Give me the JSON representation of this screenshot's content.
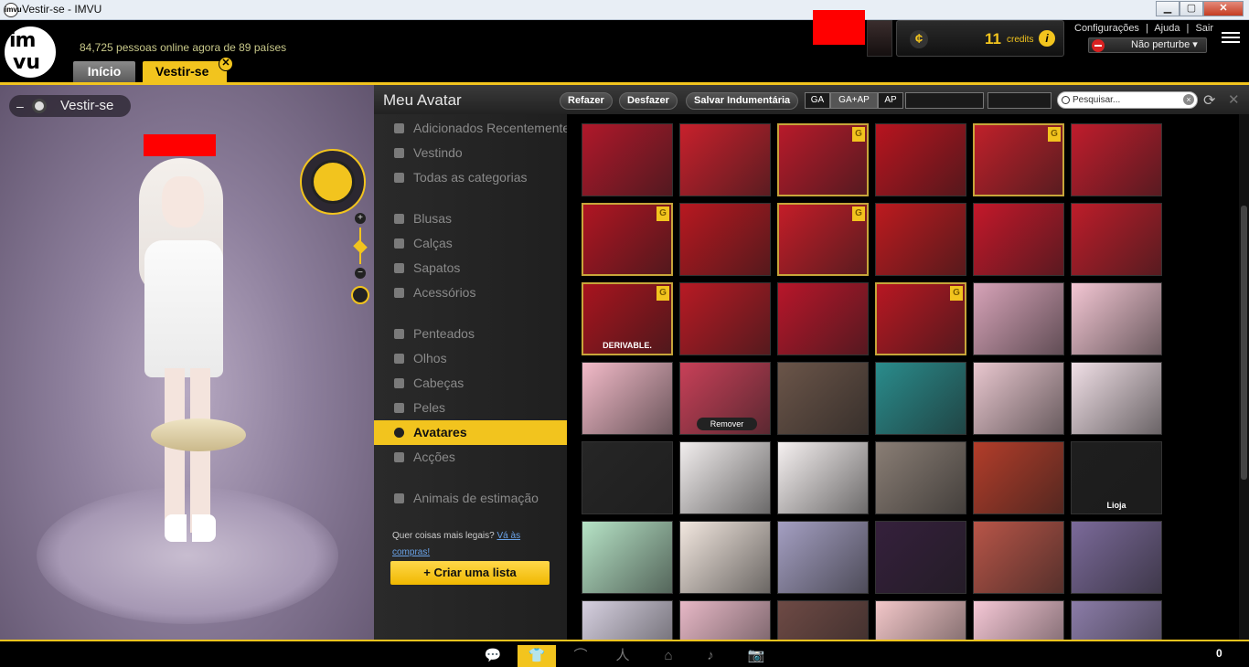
{
  "window": {
    "title": "Vestir-se - IMVU",
    "minimize": "▁",
    "maximize": "▢",
    "close": "✕"
  },
  "header": {
    "logo_top": "im",
    "logo_bottom": "vu",
    "online_text": "84,725 pessoas online agora de 89 países",
    "tabs": [
      {
        "label": "Início"
      },
      {
        "label": "Vestir-se"
      }
    ],
    "credits_value": "11",
    "credits_label": "credits",
    "menu": [
      "Configurações",
      "|",
      "Ajuda",
      "|",
      "Sair"
    ],
    "status": "Não perturbe"
  },
  "avatar_view": {
    "label": "Vestir-se",
    "minimize": "–"
  },
  "panel": {
    "title": "Meu Avatar",
    "buttons": {
      "redo": "Refazer",
      "undo": "Desfazer",
      "save": "Salvar Indumentária"
    },
    "ratings": [
      "GA",
      "GA+AP",
      "AP"
    ],
    "search_placeholder": "Pesquisar...",
    "search_clear": "×"
  },
  "categories": [
    {
      "label": "Adicionados Recentemente",
      "icon": "tag-icon",
      "active": false
    },
    {
      "label": "Vestindo",
      "icon": "person-icon",
      "active": false
    },
    {
      "label": "Todas as categorias",
      "icon": "star-icon",
      "active": false
    },
    {
      "label": "Blusas",
      "icon": "shirt-icon",
      "active": false
    },
    {
      "label": "Calças",
      "icon": "pants-icon",
      "active": false
    },
    {
      "label": "Sapatos",
      "icon": "shoe-icon",
      "active": false
    },
    {
      "label": "Acessórios",
      "icon": "gem-icon",
      "active": false
    },
    {
      "label": "Penteados",
      "icon": "hair-icon",
      "active": false
    },
    {
      "label": "Olhos",
      "icon": "eye-icon",
      "active": false
    },
    {
      "label": "Cabeças",
      "icon": "head-icon",
      "active": false
    },
    {
      "label": "Peles",
      "icon": "lips-icon",
      "active": false
    },
    {
      "label": "Avatares",
      "icon": "avatar-icon",
      "active": true
    },
    {
      "label": "Acções",
      "icon": "action-icon",
      "active": false
    },
    {
      "label": "Animais de estimação",
      "icon": "paw-icon",
      "active": false
    }
  ],
  "sidebar_footer": {
    "text": "Quer coisas mais legais?",
    "link": "Vá às compras!",
    "create_button": "Criar uma lista",
    "create_plus": "+"
  },
  "grid_items": [
    {
      "color": "#b0182a",
      "gold": false,
      "caption": ""
    },
    {
      "color": "#c8202c",
      "gold": false,
      "caption": ""
    },
    {
      "color": "#b81a2a",
      "gold": true,
      "caption": ""
    },
    {
      "color": "#b8141f",
      "gold": false,
      "caption": ""
    },
    {
      "color": "#c0202a",
      "gold": true,
      "caption": ""
    },
    {
      "color": "#c01c2c",
      "gold": false,
      "caption": ""
    },
    {
      "color": "#b01522",
      "gold": true,
      "caption": ""
    },
    {
      "color": "#b81820",
      "gold": false,
      "caption": ""
    },
    {
      "color": "#c41d28",
      "gold": true,
      "caption": ""
    },
    {
      "color": "#bd1a1f",
      "gold": false,
      "caption": ""
    },
    {
      "color": "#c4182a",
      "gold": false,
      "caption": ""
    },
    {
      "color": "#bd1d2a",
      "gold": false,
      "caption": ""
    },
    {
      "color": "#a8141e",
      "gold": true,
      "caption": "DERIVABLE."
    },
    {
      "color": "#b81a24",
      "gold": false,
      "caption": ""
    },
    {
      "color": "#b8162a",
      "gold": false,
      "caption": ""
    },
    {
      "color": "#b81722",
      "gold": true,
      "caption": ""
    },
    {
      "color": "#d7a3b8",
      "gold": false,
      "caption": ""
    },
    {
      "color": "#f3c6d3",
      "gold": false,
      "caption": ""
    },
    {
      "color": "#f2bac8",
      "gold": false,
      "caption": ""
    },
    {
      "color": "#c84058",
      "gold": false,
      "caption": "",
      "remove": "Remover"
    },
    {
      "color": "#6b5549",
      "gold": false,
      "caption": ""
    },
    {
      "color": "#2a8c8c",
      "gold": false,
      "caption": ""
    },
    {
      "color": "#e9c7cf",
      "gold": false,
      "caption": ""
    },
    {
      "color": "#f0dfe6",
      "gold": false,
      "caption": ""
    },
    {
      "color": "#262626",
      "gold": false,
      "caption": ""
    },
    {
      "color": "#f2eeee",
      "gold": false,
      "caption": ""
    },
    {
      "color": "#f6f1f1",
      "gold": false,
      "caption": ""
    },
    {
      "color": "#8a7e75",
      "gold": false,
      "caption": ""
    },
    {
      "color": "#b33d2a",
      "gold": false,
      "caption": ""
    },
    {
      "color": "#1e1e1e",
      "gold": false,
      "caption": "Lioja"
    },
    {
      "color": "#b6e3c6",
      "gold": false,
      "caption": ""
    },
    {
      "color": "#f2e7df",
      "gold": false,
      "caption": ""
    },
    {
      "color": "#a49fc2",
      "gold": false,
      "caption": ""
    },
    {
      "color": "#35203c",
      "gold": false,
      "caption": ""
    },
    {
      "color": "#b85548",
      "gold": false,
      "caption": ""
    },
    {
      "color": "#7b6a9a",
      "gold": false,
      "caption": ""
    },
    {
      "color": "#d6d0e0",
      "gold": false,
      "caption": ""
    },
    {
      "color": "#e7b8c6",
      "gold": false,
      "caption": ""
    },
    {
      "color": "#6e4a45",
      "gold": false,
      "caption": ""
    },
    {
      "color": "#f3c7c9",
      "gold": false,
      "caption": ""
    },
    {
      "color": "#f6c8d6",
      "gold": false,
      "caption": ""
    },
    {
      "color": "#8b7ca8",
      "gold": false,
      "caption": ""
    }
  ],
  "bottom": {
    "icons": [
      "chat-icon",
      "shirt-icon",
      "hanger-icon",
      "pose-icon",
      "home-icon",
      "music-icon",
      "camera-icon"
    ],
    "glyphs": [
      "💬",
      "👕",
      "⌒",
      "人",
      "⌂",
      "♪",
      "📷"
    ],
    "count": "0"
  },
  "accent": "#f2c41e"
}
